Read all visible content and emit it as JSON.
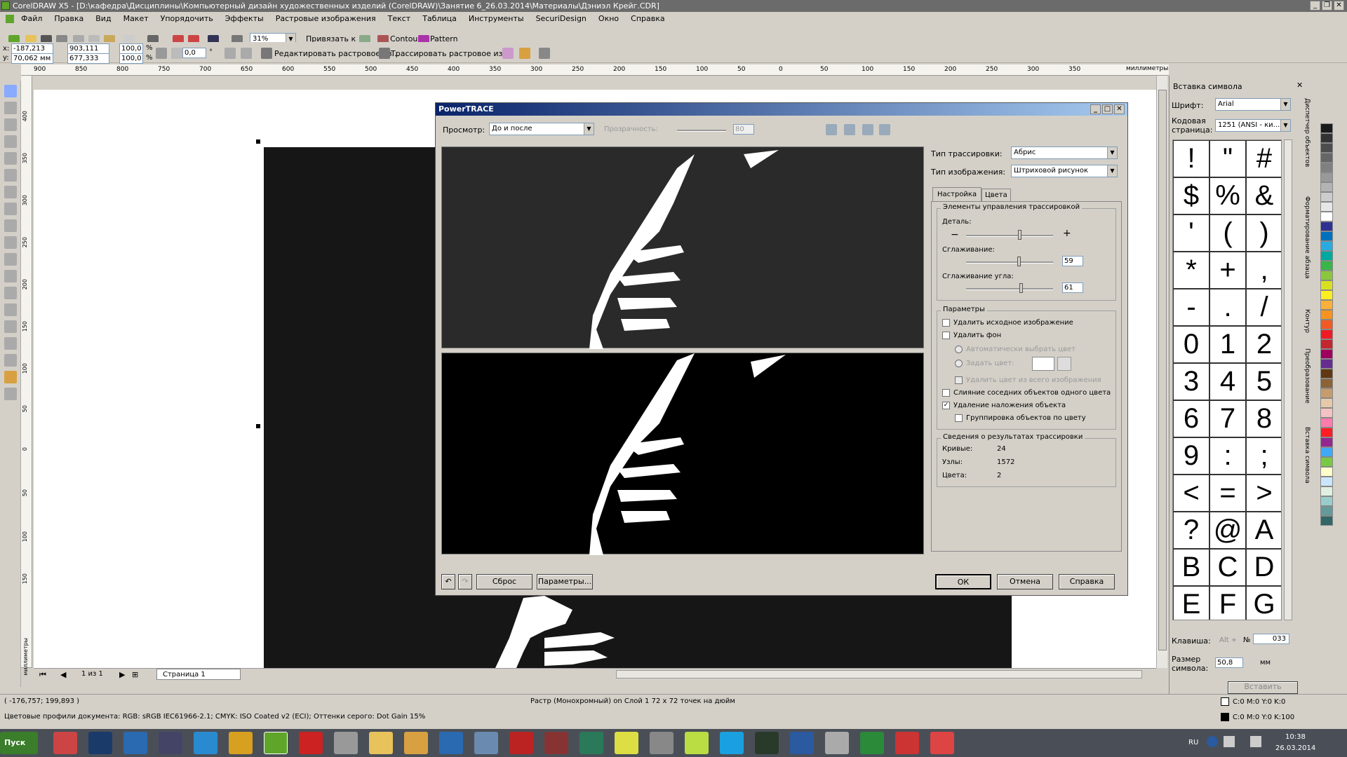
{
  "window": {
    "title": "CorelDRAW X5 - [D:\\кафедра\\Дисциплины\\Компьютерный дизайн художественных изделий (CorelDRAW)\\Занятие 6_26.03.2014\\Материалы\\Дэниэл Крейг.CDR]"
  },
  "menu": [
    "Файл",
    "Правка",
    "Вид",
    "Макет",
    "Упорядочить",
    "Эффекты",
    "Растровые изображения",
    "Текст",
    "Таблица",
    "Инструменты",
    "SecuriDesign",
    "Окно",
    "Справка"
  ],
  "toolbar": {
    "zoom": "31%",
    "snap": "Привязать к",
    "contour": "Contour",
    "pattern": "Pattern"
  },
  "propbar": {
    "x": "-187,213 мм",
    "y": "70,062 мм",
    "w": "903,111 мм",
    "h": "677,333 мм",
    "sx": "100,0",
    "sy": "100,0",
    "pct": "%",
    "angle": "0,0",
    "deg": "°",
    "edit_bitmap": "Редактировать растровое из...",
    "trace_bitmap": "Трассировать растровое из."
  },
  "ruler": {
    "units": "миллиметры",
    "ticks": [
      "900",
      "850",
      "800",
      "750",
      "700",
      "650",
      "600",
      "550",
      "500",
      "450",
      "400",
      "350",
      "300",
      "250",
      "200",
      "150",
      "100",
      "50",
      "0",
      "50",
      "100",
      "150",
      "200",
      "250",
      "300",
      "350"
    ],
    "vticks": [
      "400",
      "350",
      "300",
      "250",
      "200",
      "150",
      "100",
      "50",
      "0",
      "50",
      "100",
      "150"
    ],
    "vunits": "миллиметры"
  },
  "dialog": {
    "title": "PowerTRACE",
    "preview_label": "Просмотр:",
    "preview_value": "До и после",
    "transparency_label": "Прозрачность:",
    "transparency_value": "80",
    "trace_type_label": "Тип трассировки:",
    "trace_type_value": "Абрис",
    "image_type_label": "Тип изображения:",
    "image_type_value": "Штриховой рисунок",
    "tab_settings": "Настройка",
    "tab_colors": "Цвета",
    "controls_group": "Элементы управления трассировкой",
    "detail_label": "Деталь:",
    "detail_level": 0.6,
    "smooth_label": "Сглаживание:",
    "smooth_value": "59",
    "corner_label": "Сглаживание угла:",
    "corner_value": "61",
    "params_group": "Параметры",
    "delete_original": "Удалить исходное изображение",
    "remove_bg": "Удалить фон",
    "auto_color": "Автоматически выбрать цвет",
    "set_color": "Задать цвет:",
    "remove_color_all": "Удалить цвет из всего изображения",
    "merge_adjacent": "Слияние соседних объектов одного цвета",
    "remove_overlap": "Удаление наложения объекта",
    "group_by_color": "Группировка объектов по цвету",
    "check_mark": "✓",
    "results_group": "Сведения о результатах трассировки",
    "curves_label": "Кривые:",
    "curves_value": "24",
    "nodes_label": "Узлы:",
    "nodes_value": "1572",
    "colors_label": "Цвета:",
    "colors_value": "2",
    "reset": "Сброс",
    "options": "Параметры...",
    "ok": "ОК",
    "cancel": "Отмена",
    "help": "Справка"
  },
  "docker": {
    "title": "Вставка символа",
    "font_label": "Шрифт:",
    "font_value": "Arial",
    "codepage_label": "Кодовая страница:",
    "codepage_value": "1251  (ANSI - ки...",
    "glyphs": [
      "!",
      "\"",
      "#",
      "$",
      "%",
      "&",
      "'",
      "(",
      ")",
      "*",
      "+",
      ",",
      "-",
      ".",
      "/",
      "0",
      "1",
      "2",
      "3",
      "4",
      "5",
      "6",
      "7",
      "8",
      "9",
      ":",
      ";",
      "<",
      "=",
      ">",
      "?",
      "@",
      "A",
      "B",
      "C",
      "D",
      "E",
      "F",
      "G"
    ],
    "key_label": "Клавиша:",
    "key_hint": "Alt +",
    "no_label": "№",
    "no_value": "033",
    "size_label": "Размер символа:",
    "size_value": "50,8",
    "size_unit": "мм",
    "insert": "Вставить",
    "side_tabs": [
      "Диспетчер объектов",
      "Форматирование абзаца",
      "Контур",
      "Преобразование",
      "Вставка символа"
    ]
  },
  "page_nav": {
    "count": "1 из 1",
    "page": "Страница 1"
  },
  "status": {
    "coords": "( -176,757; 199,893 )",
    "object": "Растр (Монохромный) on Слой 1 72 x 72 точек на дюйм",
    "profiles": "Цветовые профили документа: RGB: sRGB IEC61966-2.1; CMYK: ISO Coated v2 (ECI); Оттенки серого: Dot Gain 15%",
    "fill": "C:0 M:0 Y:0 K:0",
    "outline": "C:0 M:0 Y:0 K:100"
  },
  "taskbar": {
    "start": "Пуск",
    "lang": "RU",
    "time": "10:38",
    "date": "26.03.2014"
  },
  "palette": [
    "#1a1a1a",
    "#333",
    "#4d4d4d",
    "#666",
    "#808080",
    "#999",
    "#b3b3b3",
    "#ccc",
    "#e6e6e6",
    "#fff",
    "#2e3192",
    "#0071bc",
    "#29abe2",
    "#00a99d",
    "#39b54a",
    "#8cc63f",
    "#d9e021",
    "#fcee21",
    "#fbb03b",
    "#f7931e",
    "#f15a24",
    "#ed1c24",
    "#c1272d",
    "#9e005d",
    "#662d91",
    "#603813",
    "#8c6239",
    "#c69c6d",
    "#e6c9a8",
    "#f4c2c2",
    "#ff7bac",
    "#ff1d25",
    "#93278f",
    "#3fa9f5",
    "#7ac943",
    "#ffffcc",
    "#cce5ff",
    "#e0f0e0",
    "#99cccc",
    "#669999",
    "#336666"
  ]
}
